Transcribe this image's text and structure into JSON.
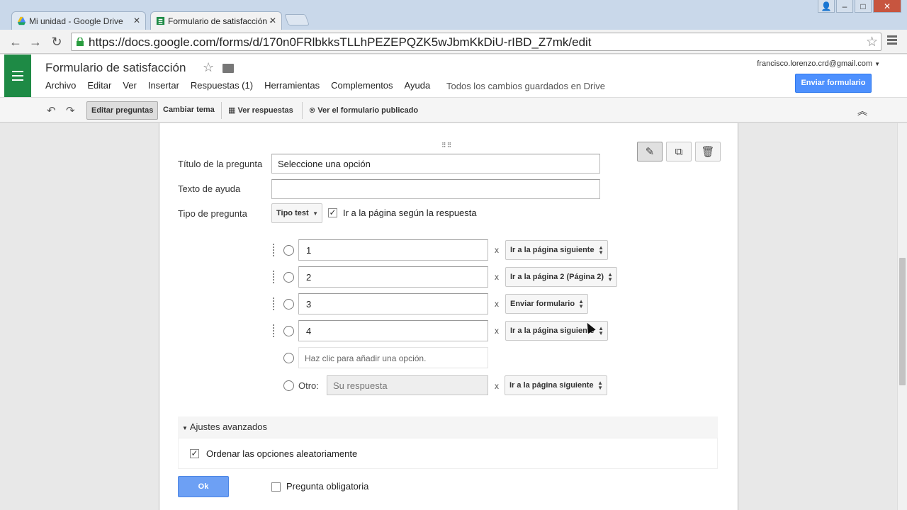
{
  "browser": {
    "tabs": [
      {
        "title": "Mi unidad - Google Drive"
      },
      {
        "title": "Formulario de satisfacción -"
      }
    ],
    "url": "https://docs.google.com/forms/d/170n0FRlbkksTLLhPEZEPQZK5wJbmKkDiU-rIBD_Z7mk/edit"
  },
  "app": {
    "doc_title": "Formulario de satisfacción",
    "menu": [
      "Archivo",
      "Editar",
      "Ver",
      "Insertar",
      "Respuestas (1)",
      "Herramientas",
      "Complementos",
      "Ayuda"
    ],
    "save_status": "Todos los cambios guardados en Drive",
    "account": "francisco.lorenzo.crd@gmail.com",
    "send_button": "Enviar formulario"
  },
  "editbar": {
    "edit_questions": "Editar preguntas",
    "change_theme": "Cambiar tema",
    "view_responses": "Ver respuestas",
    "view_published": "Ver el formulario publicado"
  },
  "question": {
    "title_label": "Título de la pregunta",
    "title_value": "Seleccione una opción",
    "help_label": "Texto de ayuda",
    "help_value": "",
    "type_label": "Tipo de pregunta",
    "type_value": "Tipo test",
    "go_to_page_label": "Ir a la página según la respuesta",
    "go_to_page_checked": true,
    "options": [
      {
        "value": "1",
        "action": "Ir a la página siguiente"
      },
      {
        "value": "2",
        "action": "Ir a la página 2 (Página 2)"
      },
      {
        "value": "3",
        "action": "Enviar formulario"
      },
      {
        "value": "4",
        "action": "Ir a la página siguiente"
      }
    ],
    "add_option_placeholder": "Haz clic para añadir una opción.",
    "other_label": "Otro:",
    "other_placeholder": "Su respuesta",
    "other_action": "Ir a la página siguiente",
    "x_mark": "x",
    "advanced_label": "Ajustes avanzados",
    "shuffle_label": "Ordenar las opciones aleatoriamente",
    "shuffle_checked": true,
    "ok_button": "Ok",
    "required_label": "Pregunta obligatoria",
    "required_checked": false
  }
}
